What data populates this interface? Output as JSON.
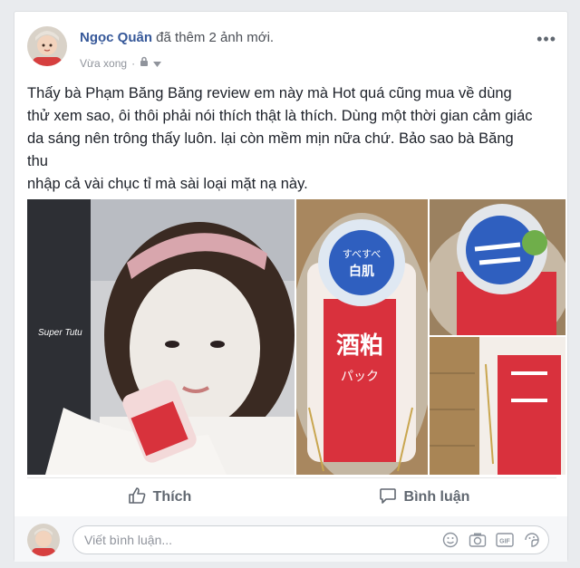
{
  "post": {
    "author": "Ngọc Quân",
    "action_text": " đã thêm 2 ảnh mới.",
    "timestamp": "Vừa xong",
    "privacy_icon": "lock-icon",
    "more_icon": "•••",
    "text_lines": [
      "Thấy bà Phạm Băng Băng review em này mà Hot quá cũng mua về dùng",
      "thử xem sao, ôi thôi phải nói thích thật là thích. Dùng một thời gian cảm giác",
      "da sáng nên trông thấy luôn. lại còn mềm mịn nữa chứ. Bảo sao bà Băng",
      "thu",
      "nhập cả vài chục tỉ mà sài loại mặt nạ này."
    ],
    "photo_watermark": "Super Tutu",
    "package_text": {
      "top": "すべすべ",
      "white": "白肌",
      "red": "酒粕",
      "pack": "パック"
    }
  },
  "actions": {
    "like_label": "Thích",
    "comment_label": "Bình luận"
  },
  "comment": {
    "placeholder": "Viết bình luận...",
    "gif_label": "GIF"
  },
  "colors": {
    "link": "#365899",
    "text": "#1d2129",
    "muted": "#90949c",
    "background": "#e9ebee"
  }
}
